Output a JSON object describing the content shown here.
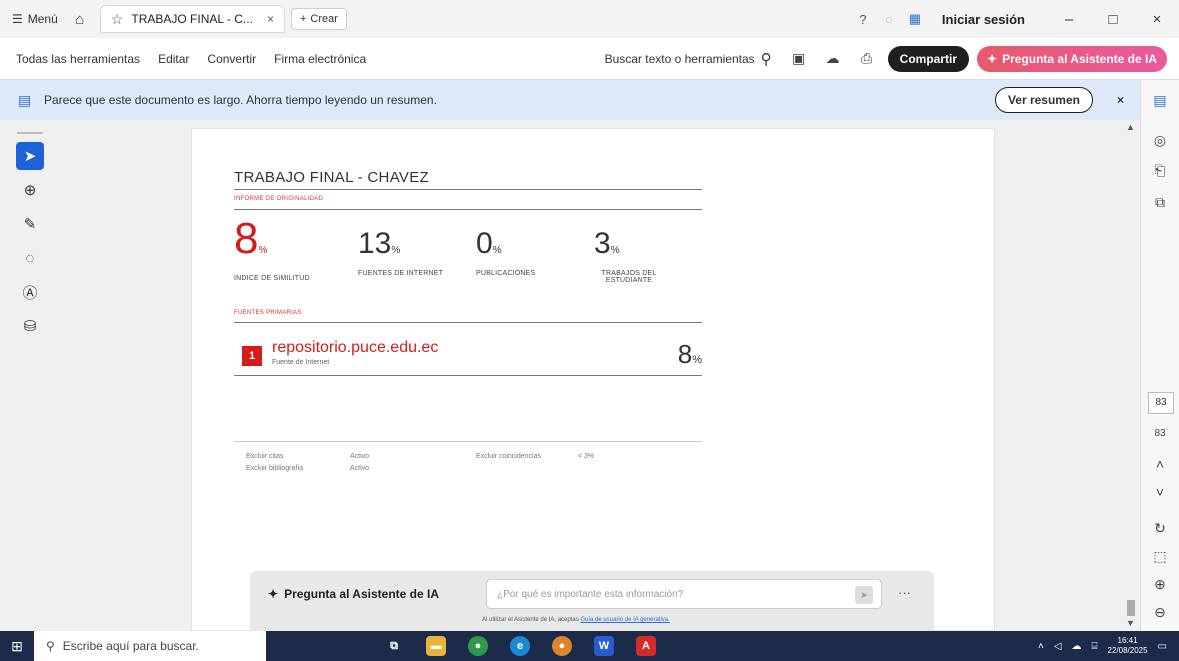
{
  "titlebar": {
    "menu_label": "Menú",
    "tab_title": "TRABAJO FINAL - C...",
    "new_tab_label": "Crear",
    "signin_label": "Iniciar sesión"
  },
  "toolbar": {
    "tools": [
      "Todas las herramientas",
      "Editar",
      "Convertir",
      "Firma electrónica"
    ],
    "search_label": "Buscar texto o herramientas",
    "share_label": "Compartir",
    "ai_label": "Pregunta al Asistente de IA"
  },
  "banner": {
    "text": "Parece que este documento es largo. Ahorra tiempo leyendo un resumen.",
    "button_label": "Ver resumen"
  },
  "document": {
    "title": "TRABAJO FINAL - CHAVEZ",
    "section_originality": "INFORME DE ORIGINALIDAD",
    "stats": [
      {
        "value": "8",
        "unit": "%",
        "label": "INDICE DE SIMILITUD"
      },
      {
        "value": "13",
        "unit": "%",
        "label": "FUENTES DE INTERNET"
      },
      {
        "value": "0",
        "unit": "%",
        "label": "PUBLICACIONES"
      },
      {
        "value": "3",
        "unit": "%",
        "label": "TRABAJOS DEL ESTUDIANTE"
      }
    ],
    "section_sources": "FUENTES PRIMARIAS",
    "source": {
      "number": "1",
      "domain": "repositorio.puce.edu.ec",
      "type": "Fuente de Internet",
      "value": "8",
      "unit": "%"
    },
    "footer": {
      "excluir_citas": "Excluir citas",
      "excluir_citas_val": "Activo",
      "excluir_bib": "Excluir bibliografía",
      "excluir_bib_val": "Activo",
      "excluir_coinc": "Excluir coincidencias",
      "excluir_coinc_val": "< 3%"
    }
  },
  "sidebar_right": {
    "page_current": "83",
    "page_total": "83"
  },
  "ai_bar": {
    "label": "Pregunta al Asistente de IA",
    "placeholder": "¿Por qué es importante esta información?",
    "note_prefix": "Al utilizar el Asistente de IA, aceptas",
    "note_link": "Guía de usuario de IA generativa."
  },
  "taskbar": {
    "search_placeholder": "Escribe aquí para buscar.",
    "time": "16:41",
    "date": "22/08/2025"
  },
  "colors": {
    "accent_red": "#d41c1c",
    "banner_bg": "#dde9f8",
    "ai_gradient_start": "#e85a6a",
    "tool_active": "#1d62d8"
  }
}
